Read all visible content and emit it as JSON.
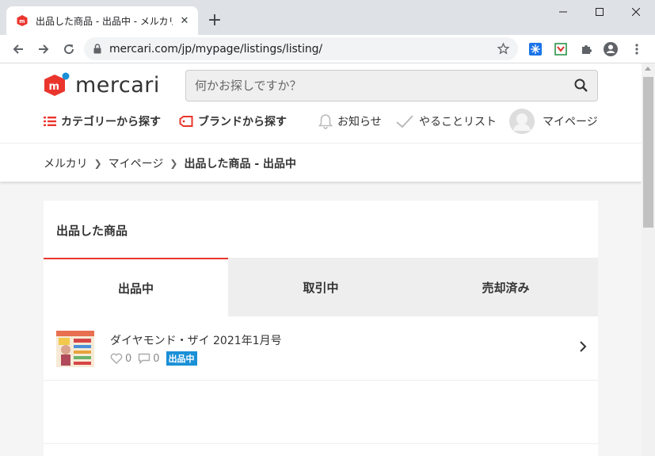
{
  "browser": {
    "tab_title": "出品した商品 - 出品中 - メルカリ ス",
    "url": "mercari.com/jp/mypage/listings/listing/"
  },
  "header": {
    "logo_text": "mercari",
    "search_placeholder": "何かお探しですか？",
    "nav": {
      "category": "カテゴリーから探す",
      "brand": "ブランドから探す",
      "notifications": "お知らせ",
      "todo": "やることリスト",
      "mypage": "マイページ"
    }
  },
  "breadcrumb": {
    "home": "メルカリ",
    "mypage": "マイページ",
    "current": "出品した商品 - 出品中"
  },
  "main": {
    "title": "出品した商品",
    "tabs": [
      {
        "label": "出品中",
        "active": true
      },
      {
        "label": "取引中",
        "active": false
      },
      {
        "label": "売却済み",
        "active": false
      }
    ],
    "listings": [
      {
        "name": "ダイヤモンド・ザイ 2021年1月号",
        "likes": "0",
        "comments": "0",
        "status": "出品中"
      }
    ]
  },
  "colors": {
    "brand_red": "#ea352d",
    "status_blue": "#1a90d6"
  }
}
